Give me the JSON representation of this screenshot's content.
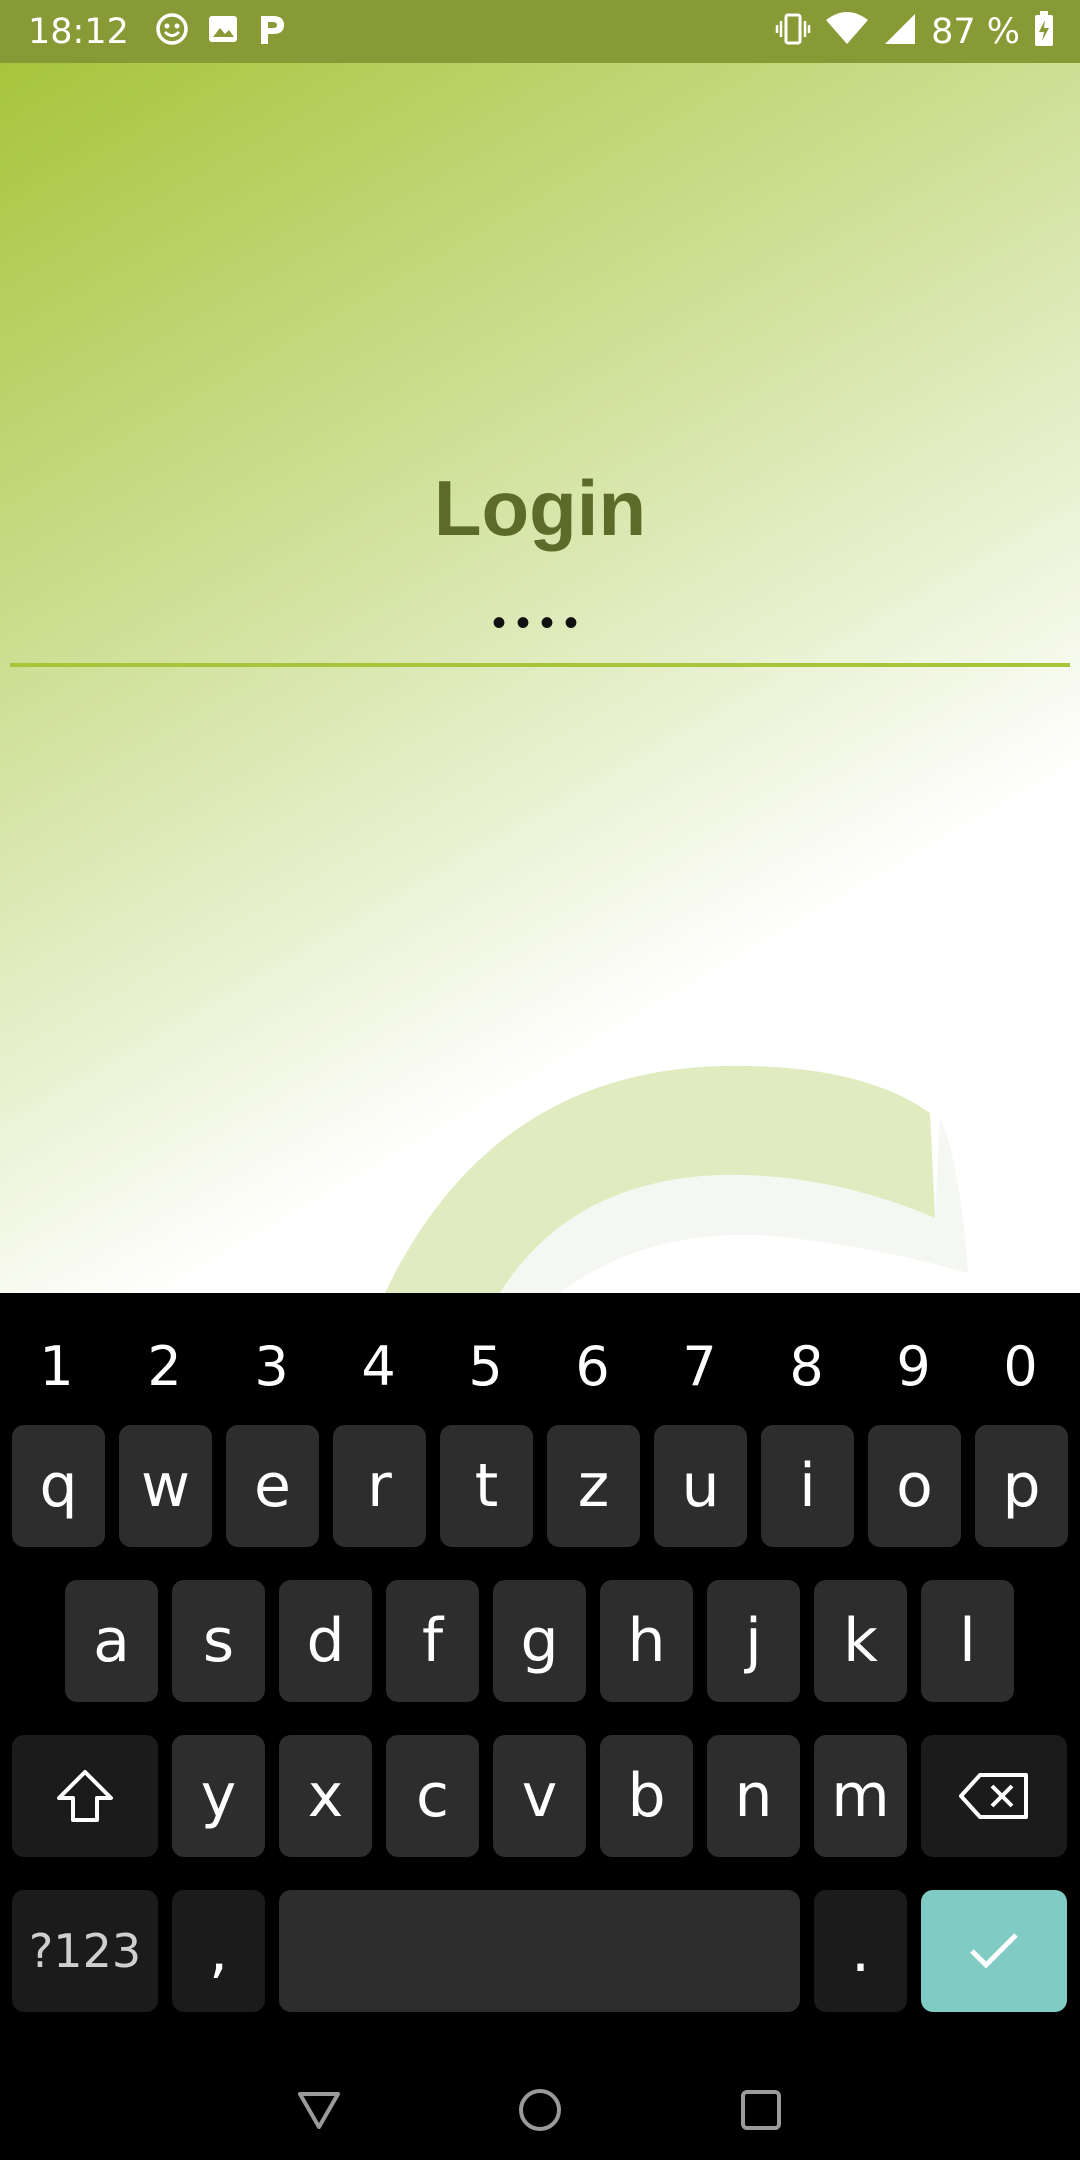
{
  "status_bar": {
    "time": "18:12",
    "battery": "87 %",
    "left_icons": [
      "emoji-notification-icon",
      "image-notification-icon",
      "p-notification-icon"
    ],
    "right_icons": [
      "vibrate-icon",
      "wifi-icon",
      "signal-icon",
      "battery-charging-icon"
    ]
  },
  "login": {
    "title": "Login",
    "password_value": "••••"
  },
  "keyboard": {
    "numbers": [
      "1",
      "2",
      "3",
      "4",
      "5",
      "6",
      "7",
      "8",
      "9",
      "0"
    ],
    "row1": [
      "q",
      "w",
      "e",
      "r",
      "t",
      "z",
      "u",
      "i",
      "o",
      "p"
    ],
    "row2": [
      "a",
      "s",
      "d",
      "f",
      "g",
      "h",
      "j",
      "k",
      "l"
    ],
    "row3": [
      "y",
      "x",
      "c",
      "v",
      "b",
      "n",
      "m"
    ],
    "symbols_label": "?123",
    "comma": ",",
    "period": ".",
    "enter_color": "#80cbc4"
  },
  "colors": {
    "accent": "#a6c53b",
    "title": "#5c6a2a",
    "status_bar": "#889a35"
  }
}
